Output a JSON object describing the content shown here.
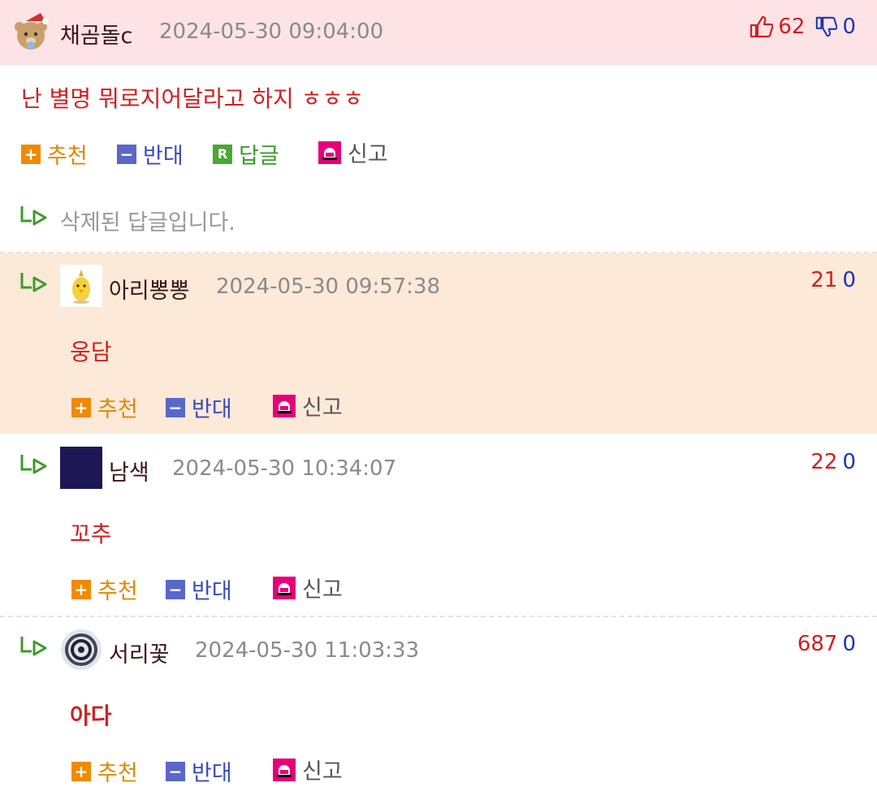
{
  "main_comment": {
    "nickname": "채곰돌c",
    "date": "2024-05-30 09:04:00",
    "up": "62",
    "down": "0",
    "message": "난 별명 뭐로지어달라고 하지 ㅎㅎㅎ",
    "actions": {
      "recommend": "추천",
      "oppose": "반대",
      "reply": "답글",
      "report": "신고"
    },
    "deleted_reply": "삭제된 답글입니다."
  },
  "replies": [
    {
      "nickname": "아리뽕뽕",
      "date": "2024-05-30 09:57:38",
      "up": "21",
      "down": "0",
      "message": "웅담"
    },
    {
      "nickname": "남색",
      "date": "2024-05-30 10:34:07",
      "up": "22",
      "down": "0",
      "message": "꼬추"
    },
    {
      "nickname": "서리꽃",
      "date": "2024-05-30 11:03:33",
      "up": "687",
      "down": "0",
      "message": "아다"
    }
  ],
  "reply_actions": {
    "recommend": "추천",
    "oppose": "반대",
    "report": "신고"
  },
  "icons": {
    "thumbs_up": "thumbs-up-icon",
    "thumbs_down": "thumbs-down-icon",
    "reply_arrow": "reply-arrow-icon",
    "plus": "plus-icon",
    "minus": "minus-icon",
    "reply_r": "reply-r-icon",
    "siren": "siren-icon"
  },
  "colors": {
    "head_bg": "#fde3e6",
    "highlight_bg": "#fde9d8",
    "up": "#d02020",
    "down": "#1a35b8"
  }
}
